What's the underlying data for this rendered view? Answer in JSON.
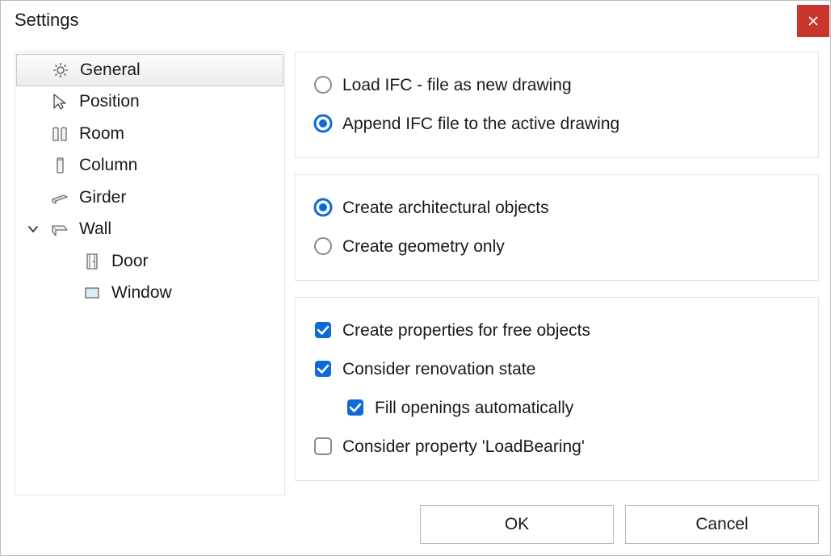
{
  "title": "Settings",
  "sidebar": [
    {
      "key": "general",
      "label": "General",
      "level": 0,
      "expandable": false,
      "selected": true
    },
    {
      "key": "position",
      "label": "Position",
      "level": 0,
      "expandable": false,
      "selected": false
    },
    {
      "key": "room",
      "label": "Room",
      "level": 0,
      "expandable": false,
      "selected": false
    },
    {
      "key": "column",
      "label": "Column",
      "level": 0,
      "expandable": false,
      "selected": false
    },
    {
      "key": "girder",
      "label": "Girder",
      "level": 0,
      "expandable": false,
      "selected": false
    },
    {
      "key": "wall",
      "label": "Wall",
      "level": 0,
      "expandable": true,
      "expanded": true,
      "selected": false
    },
    {
      "key": "door",
      "label": "Door",
      "level": 1,
      "expandable": false,
      "selected": false
    },
    {
      "key": "window",
      "label": "Window",
      "level": 1,
      "expandable": false,
      "selected": false
    }
  ],
  "groups": {
    "load": {
      "radio_new": "Load IFC - file as new drawing",
      "radio_append": "Append IFC file to the active drawing",
      "selected": "append"
    },
    "create": {
      "radio_arch": "Create architectural objects",
      "radio_geom": "Create geometry only",
      "selected": "arch"
    },
    "options": {
      "chk_props": {
        "label": "Create properties for free objects",
        "checked": true
      },
      "chk_renov": {
        "label": "Consider renovation state",
        "checked": true
      },
      "chk_fill": {
        "label": "Fill openings automatically",
        "checked": true
      },
      "chk_loadb": {
        "label": "Consider property 'LoadBearing'",
        "checked": false
      }
    }
  },
  "buttons": {
    "ok": "OK",
    "cancel": "Cancel"
  },
  "colors": {
    "accent": "#0c6ad9",
    "close": "#c8352c"
  }
}
